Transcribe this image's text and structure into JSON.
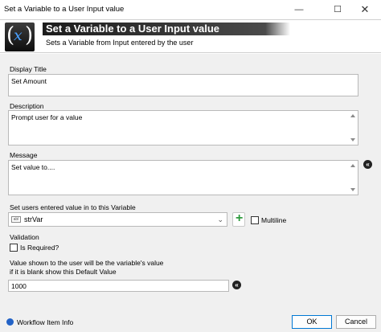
{
  "window": {
    "title": "Set a Variable to a User Input value",
    "minimize": "—",
    "maximize": "☐",
    "close": "✕"
  },
  "header": {
    "banner": "Set a Variable to a User Input value",
    "subtitle": "Sets a Variable from Input entered by the user",
    "logo_left": "(",
    "logo_x": "x",
    "logo_right": ")"
  },
  "form": {
    "display_title_label": "Display Title",
    "display_title_value": "Set Amount",
    "description_label": "Description",
    "description_value": "Prompt user for a value",
    "message_label": "Message",
    "message_value": "Set value to....",
    "variable_label": "Set users entered value in to this Variable",
    "variable_value": "strVar",
    "variable_type_badge": "abl",
    "multiline_label": "Multiline",
    "validation_label": "Validation",
    "is_required_label": "Is Required?",
    "default_label_line1": "Value shown to the user will be the variable's value",
    "default_label_line2": "if it is blank show this Default Value",
    "default_value": "1000"
  },
  "footer": {
    "info_label": "Workflow Item Info",
    "ok_label": "OK",
    "cancel_label": "Cancel"
  },
  "icons": {
    "clear": "«",
    "add": "+",
    "chevron": "⌄"
  },
  "colors": {
    "banner_dark": "#1c1c1c",
    "logo_x": "#4aa0ff",
    "add_green": "#2e9a3d",
    "info_blue": "#2262c6",
    "ok_border": "#0078d4"
  }
}
